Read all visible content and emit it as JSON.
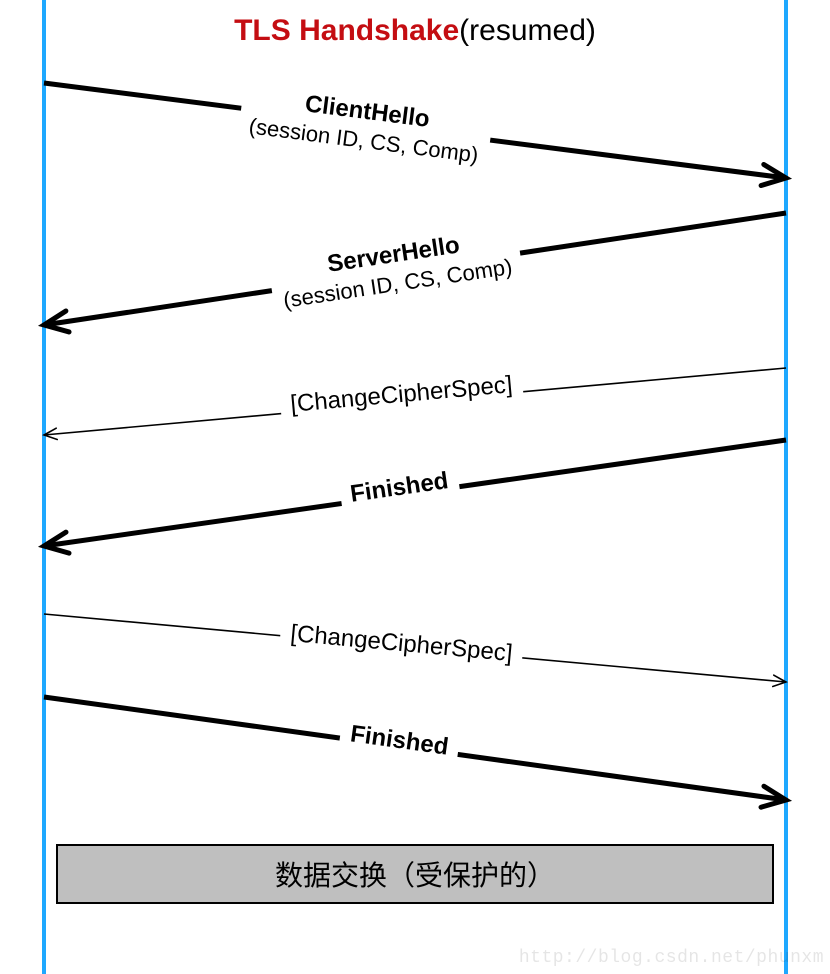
{
  "title": {
    "strong": "TLS Handshake",
    "tail": "(resumed)"
  },
  "colors": {
    "lifeline": "#1ea8ff",
    "titleStrong": "#c40d12",
    "databox": "#bfbfbf"
  },
  "geometry": {
    "leftX": 44,
    "rightX": 786
  },
  "messages": [
    {
      "id": "m1",
      "dir": "right",
      "yStart": 83,
      "yEnd": 178,
      "style": "bold",
      "name": "ClientHello",
      "sub": "(session ID, CS, Comp)",
      "labelTop": 95,
      "labelAngle": 7.3
    },
    {
      "id": "m2",
      "dir": "left",
      "yStart": 213,
      "yEnd": 325,
      "style": "bold",
      "name": "ServerHello",
      "sub": "(session ID, CS, Comp)",
      "labelTop": 238,
      "labelAngle": -8.5
    },
    {
      "id": "m3",
      "dir": "left",
      "yStart": 368,
      "yEnd": 435,
      "style": "thin",
      "thinLabel": "[ChangeCipherSpec]",
      "labelTop": 378,
      "labelAngle": -5.1
    },
    {
      "id": "m4",
      "dir": "left",
      "yStart": 440,
      "yEnd": 546,
      "style": "bold",
      "name": "Finished",
      "labelTop": 471,
      "labelAngle": -8.1
    },
    {
      "id": "m5",
      "dir": "right",
      "yStart": 614,
      "yEnd": 682,
      "style": "thin",
      "thinLabel": "[ChangeCipherSpec]",
      "labelTop": 627,
      "labelAngle": 5.2
    },
    {
      "id": "m6",
      "dir": "right",
      "yStart": 697,
      "yEnd": 800,
      "style": "bold",
      "name": "Finished",
      "labelTop": 724,
      "labelAngle": 7.9
    }
  ],
  "databox": "数据交换（受保护的）",
  "watermark": "http://blog.csdn.net/phunxm"
}
